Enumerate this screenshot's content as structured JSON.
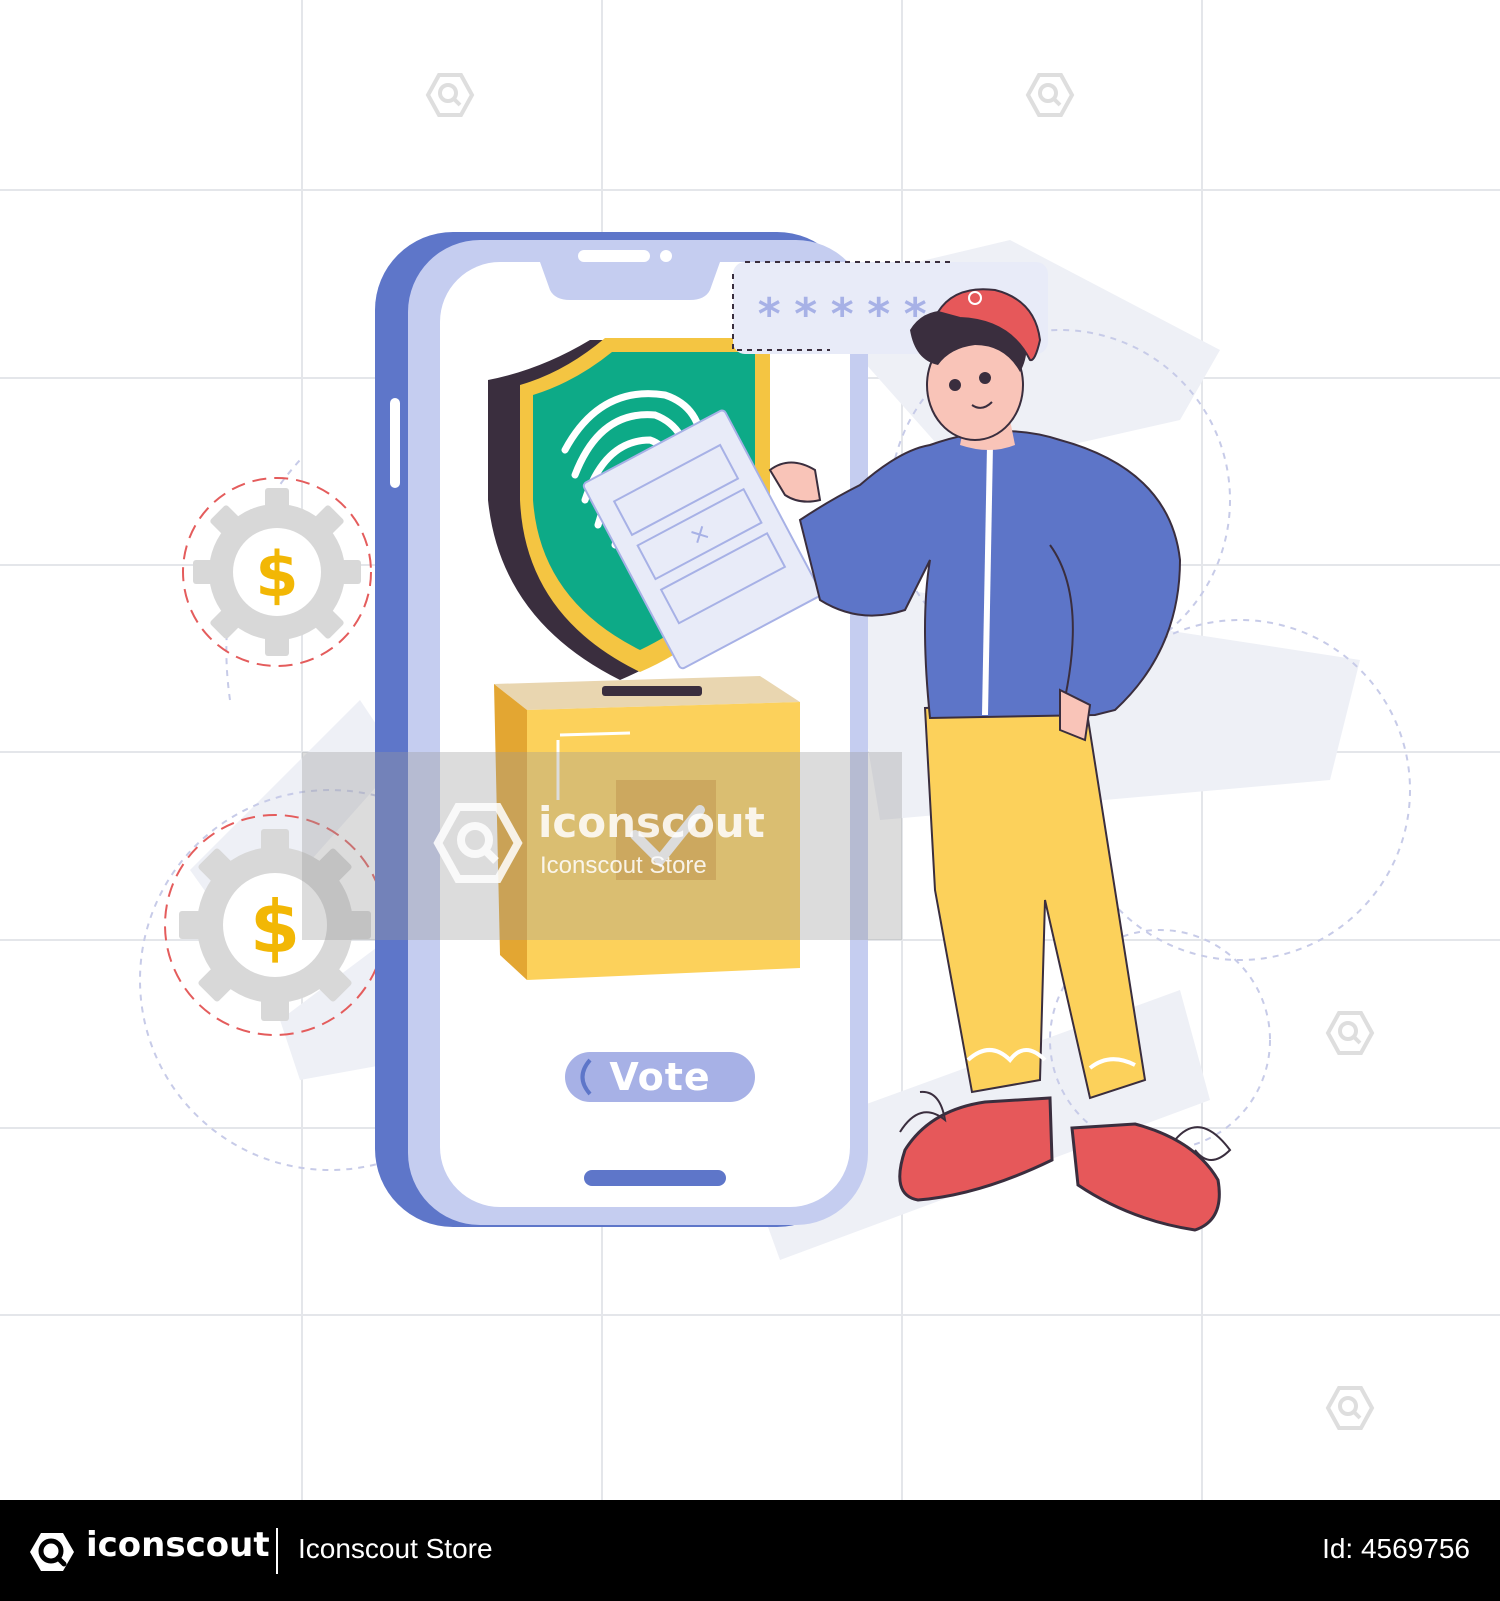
{
  "illustration": {
    "vote_button_label": "Vote",
    "password_mask": "*****",
    "currency_symbol": "$"
  },
  "watermark": {
    "brand": "iconscout",
    "store": "Iconscout Store"
  },
  "footer": {
    "brand": "iconscout",
    "store": "Iconscout Store",
    "id_text": "Id: 4569756"
  },
  "colors": {
    "phone_frame": "#5e76c9",
    "phone_screen_border": "#c5cdf0",
    "shield_green": "#0daa87",
    "shield_gold": "#f4c542",
    "ballot_box": "#fcd15b",
    "jacket": "#5d75c8",
    "pants": "#fcd15b",
    "shoes": "#e6585a",
    "footer_bg": "#000000"
  }
}
